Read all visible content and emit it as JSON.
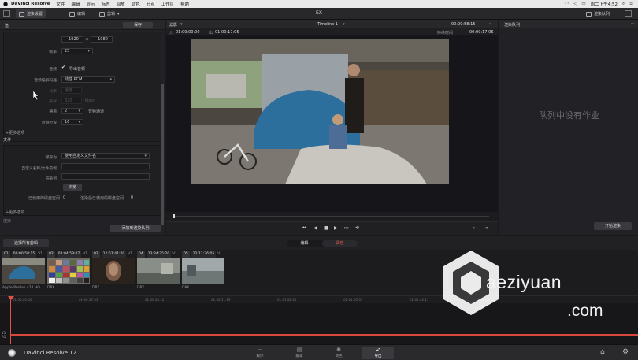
{
  "menubar": {
    "app": "DaVinci Resolve",
    "items": [
      "文件",
      "编辑",
      "显示",
      "标志",
      "回放",
      "调色",
      "节点",
      "工作区",
      "帮助"
    ],
    "clock": "周二下午4:52"
  },
  "titlebar": {
    "render_settings": "渲染设置",
    "clips_label": "编辑",
    "edit_label": "剪辑",
    "project_title": "EX",
    "render_queue": "渲染队列"
  },
  "render_settings": {
    "header": "渲",
    "header_btn": "保存",
    "res_w": "1920",
    "res_x": "x",
    "res_h": "1080",
    "framerate_label": "帧率",
    "framerate": "25",
    "audio_label": "音频",
    "export_audio": "导出音频",
    "audio_codec_label": "音频编解码器",
    "audio_codec": "线性 PCM",
    "rate_label": "比率",
    "rate_value": "速度",
    "sample_label": "采样",
    "sample_value": "320",
    "sample_unit": "kbps",
    "channels_label": "通道",
    "channels": "2",
    "channels_suffix": "音频通道",
    "bit_depth_label": "音频位深",
    "bit_depth": "16",
    "more_options": "+更多选项",
    "file_section": "文件",
    "save_as_label": "保存为",
    "save_as": "使用自定义文件名",
    "custom_name_label": "自定义名称/文件前缀",
    "location_label": "渲染到",
    "browse": "浏览",
    "disk_used_label": "已使用的磁盘空间",
    "disk_used": "0",
    "disk_remaining_label": "渲染后已使用的磁盘空间",
    "disk_remaining": "0",
    "more_options2": "+更多选项",
    "add_to_queue": "添加到渲染队列",
    "bottom_label": "渲染"
  },
  "viewer": {
    "clip_label": "滤影",
    "tc_left_label": "入",
    "tc_in": "01:00:00:00",
    "tc_right_label": "出",
    "tc_out": "01:00:17:05",
    "timeline_name": "Timeline 1",
    "duration": "00:00:58:15",
    "tc_current_label": "持续时间",
    "tc_current": "00:00:17:06"
  },
  "queue": {
    "title": "渲染队列",
    "empty": "队列中没有作业",
    "start": "开始渲染"
  },
  "clipbar": {
    "select_all": "选择所有剪辑",
    "tab_edit": "编辑",
    "tab_color": "调色"
  },
  "clips": [
    {
      "num": "01",
      "tc": "00:00:58:15",
      "track": "V1",
      "caption": "Apple ProRes 422 HQ",
      "color": "#6a7c8a"
    },
    {
      "num": "02",
      "tc": "02:04:59:07",
      "track": "V1",
      "caption": "DPX",
      "color": "#8a8070"
    },
    {
      "num": "03",
      "tc": "11:57:41:20",
      "track": "V1",
      "caption": "DPX",
      "color": "#5a4a3e"
    },
    {
      "num": "04",
      "tc": "13:34:35:20",
      "track": "V1",
      "caption": "DPX",
      "color": "#7a8078"
    },
    {
      "num": "05",
      "tc": "12:11:36:05",
      "track": "V1",
      "caption": "DPX",
      "color": "#8a9090"
    }
  ],
  "timeline": {
    "ticks": [
      "01:00:00:00",
      "01:00:17:05",
      "01:00:34:12",
      "01:00:51:19",
      "01:01:08:24",
      "01:01:26:05",
      "01:01:43:11",
      "01:02:00:16"
    ],
    "track": "V1\nA1"
  },
  "bottombar": {
    "brand": "DaVinci Resolve 12",
    "tabs": [
      "媒体",
      "编辑",
      "调色",
      "导出"
    ]
  },
  "watermark": {
    "line1": "aeziyuan",
    "line2": ".com"
  }
}
